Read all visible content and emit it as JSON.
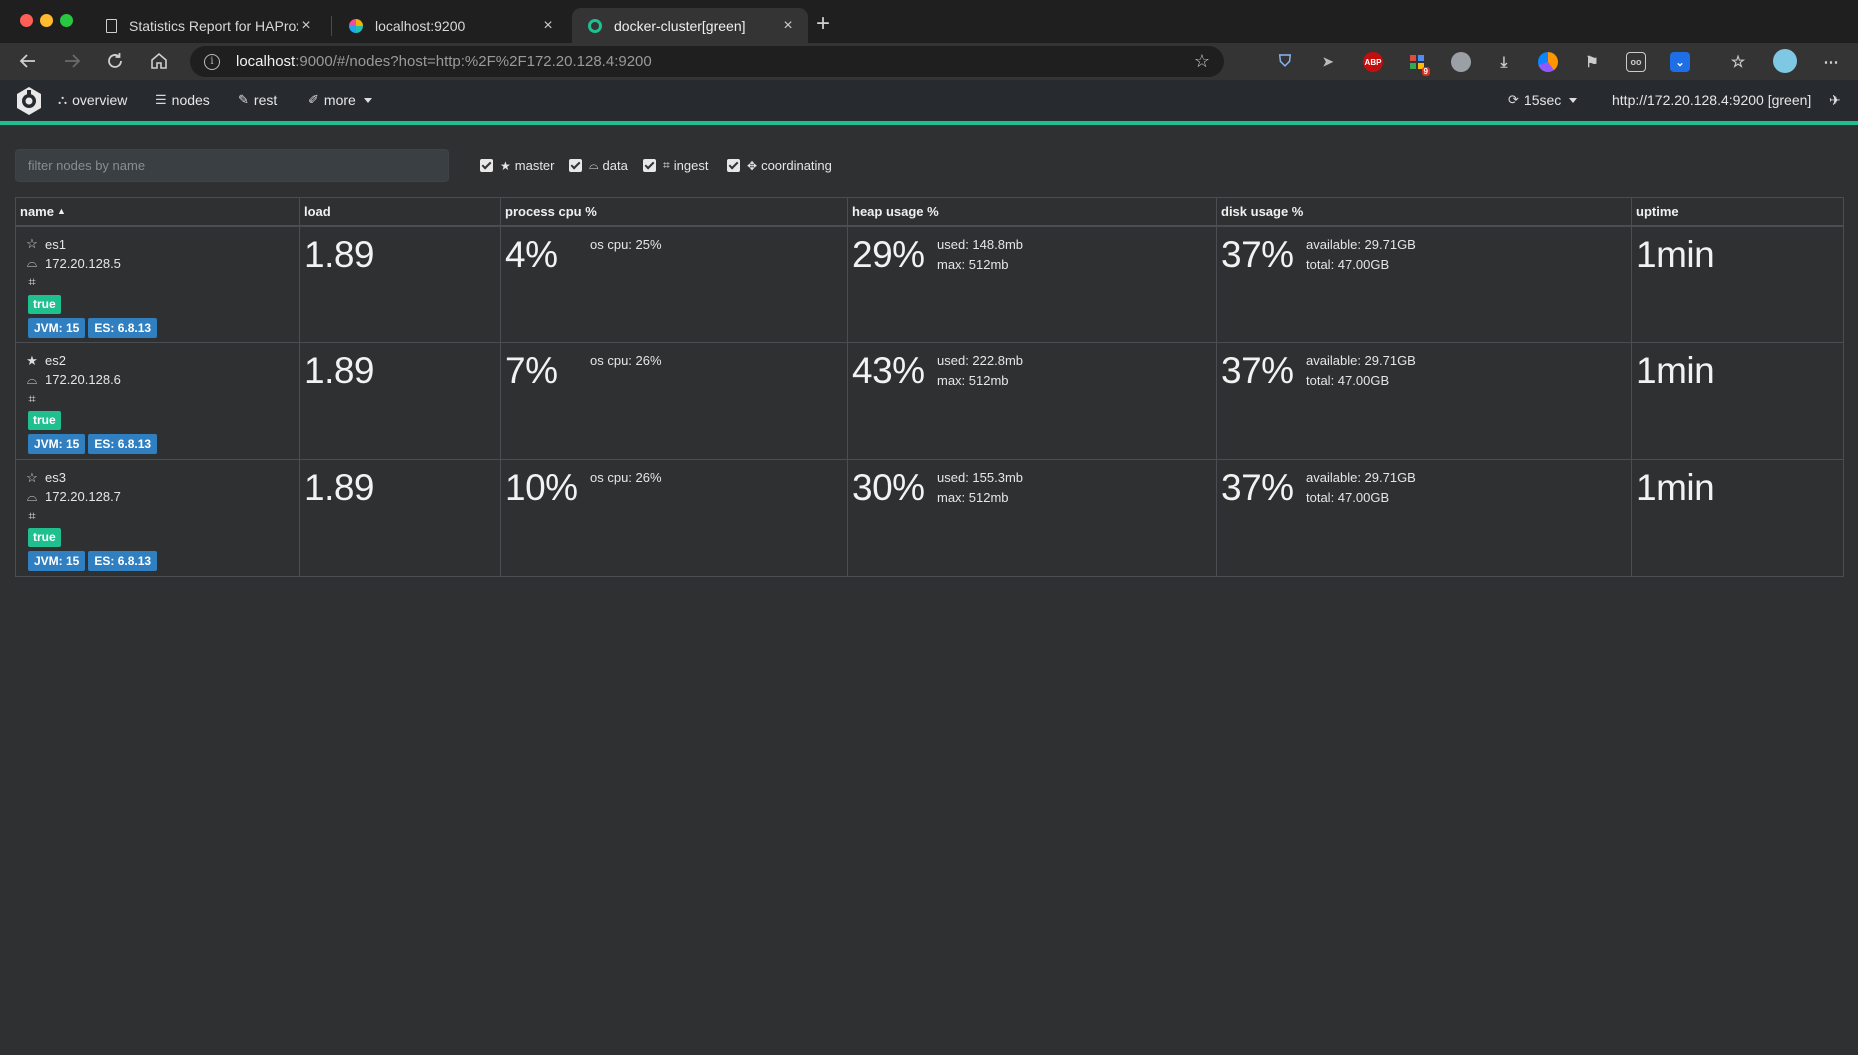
{
  "browser": {
    "tabs": [
      {
        "title": "Statistics Report for HAProxy",
        "icon": "document-icon"
      },
      {
        "title": "localhost:9200",
        "icon": "elastic-favicon-icon"
      },
      {
        "title": "docker-cluster[green]",
        "icon": "cerebro-favicon-icon",
        "active": true
      }
    ],
    "close_glyph": "×",
    "new_tab_glyph": "+",
    "url_host": "localhost",
    "url_rest": ":9000/#/nodes?host=http:%2F%2F172.20.128.4:9200",
    "info_glyph": "i",
    "extensions": [
      {
        "name": "abp-icon",
        "text": "ABP",
        "color": "#c40e0e"
      },
      {
        "name": "badge-count",
        "text": "9"
      }
    ]
  },
  "app": {
    "nav": {
      "overview": "overview",
      "nodes": "nodes",
      "rest": "rest",
      "more": "more"
    },
    "refresh_interval": "15sec",
    "cluster_url": "http://172.20.128.4:9200 [green]",
    "accent_color": "#1fbf8f"
  },
  "filters": {
    "placeholder": "filter nodes by name",
    "roles": [
      {
        "label": "master",
        "checked": true
      },
      {
        "label": "data",
        "checked": true
      },
      {
        "label": "ingest",
        "checked": true
      },
      {
        "label": "coordinating",
        "checked": true
      }
    ]
  },
  "table": {
    "columns": [
      "name",
      "load",
      "process cpu %",
      "heap usage %",
      "disk usage %",
      "uptime"
    ],
    "sort_column": "name",
    "rows": [
      {
        "name": "es1",
        "is_master": false,
        "ip": "172.20.128.5",
        "ingest": "true",
        "jvm": "JVM: 15",
        "es": "ES: 6.8.13",
        "load": "1.89",
        "cpu": "4%",
        "os_cpu": "os cpu: 25%",
        "heap": "29%",
        "heap_used": "used: 148.8mb",
        "heap_max": "max: 512mb",
        "disk": "37%",
        "disk_available": "available: 29.71GB",
        "disk_total": "total: 47.00GB",
        "uptime": "1min"
      },
      {
        "name": "es2",
        "is_master": true,
        "ip": "172.20.128.6",
        "ingest": "true",
        "jvm": "JVM: 15",
        "es": "ES: 6.8.13",
        "load": "1.89",
        "cpu": "7%",
        "os_cpu": "os cpu: 26%",
        "heap": "43%",
        "heap_used": "used: 222.8mb",
        "heap_max": "max: 512mb",
        "disk": "37%",
        "disk_available": "available: 29.71GB",
        "disk_total": "total: 47.00GB",
        "uptime": "1min"
      },
      {
        "name": "es3",
        "is_master": false,
        "ip": "172.20.128.7",
        "ingest": "true",
        "jvm": "JVM: 15",
        "es": "ES: 6.8.13",
        "load": "1.89",
        "cpu": "10%",
        "os_cpu": "os cpu: 26%",
        "heap": "30%",
        "heap_used": "used: 155.3mb",
        "heap_max": "max: 512mb",
        "disk": "37%",
        "disk_available": "available: 29.71GB",
        "disk_total": "total: 47.00GB",
        "uptime": "1min"
      }
    ]
  }
}
